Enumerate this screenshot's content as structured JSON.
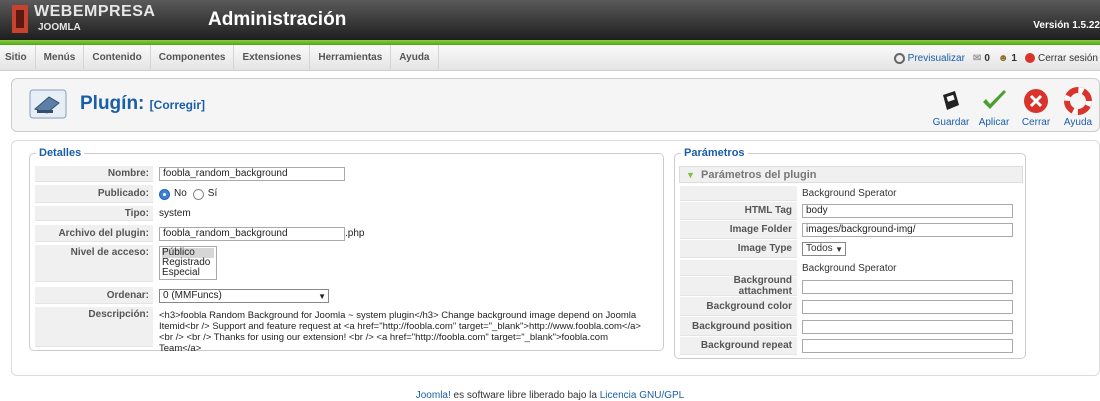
{
  "header": {
    "brand": "WEBEMPRESA",
    "brand_sub": "JOOMLA",
    "title": "Administración",
    "version": "Versión 1.5.22"
  },
  "menu": {
    "items": [
      "Sitio",
      "Menús",
      "Contenido",
      "Componentes",
      "Extensiones",
      "Herramientas",
      "Ayuda"
    ]
  },
  "status": {
    "preview": "Previsualizar",
    "messages_count": "0",
    "users_count": "1",
    "logout": "Cerrar sesión"
  },
  "toolbar": {
    "title": "Plugín:",
    "subtitle": "[Corregir]",
    "buttons": [
      "Guardar",
      "Aplicar",
      "Cerrar",
      "Ayuda"
    ]
  },
  "details": {
    "legend": "Detalles",
    "name_label": "Nombre:",
    "name_value": "foobla_random_background",
    "published_label": "Publicado:",
    "published_no": "No",
    "published_yes": "Sí",
    "type_label": "Tipo:",
    "type_value": "system",
    "file_label": "Archivo del plugin:",
    "file_value": "foobla_random_background",
    "file_ext": ".php",
    "access_label": "Nivel de acceso:",
    "access_options": [
      "Público",
      "Registrado",
      "Especial"
    ],
    "order_label": "Ordenar:",
    "order_value": "0 (MMFuncs)",
    "desc_label": "Descripción:",
    "desc_value": "<h3>foobla Random Background for Joomla ~ system plugin</h3> Change background image depend on Joomla Itemid<br /> Support and feature request at <a href=\"http://foobla.com\" target=\"_blank\">http://www.foobla.com</a> <br /> <br /> Thanks for using our extension! <br /> <a href=\"http://foobla.com\" target=\"_blank\">foobla.com Team</a>"
  },
  "params": {
    "legend": "Parámetros",
    "pane_title": "Parámetros del plugin",
    "separator1": "Background Sperator",
    "html_tag_label": "HTML Tag",
    "html_tag_value": "body",
    "image_folder_label": "Image Folder",
    "image_folder_value": "images/background-img/",
    "image_type_label": "Image Type",
    "image_type_value": "Todos",
    "separator2": "Background Sperator",
    "bg_attachment_label": "Background attachment",
    "bg_color_label": "Background color",
    "bg_position_label": "Background position",
    "bg_repeat_label": "Background repeat"
  },
  "footer": {
    "joomla_link": "Joomla!",
    "text": " es software libre liberado bajo la ",
    "license_link": "Licencia GNU/GPL"
  },
  "colors": {
    "accent": "#1a5ea8",
    "header_green": "#6cbd2c"
  }
}
